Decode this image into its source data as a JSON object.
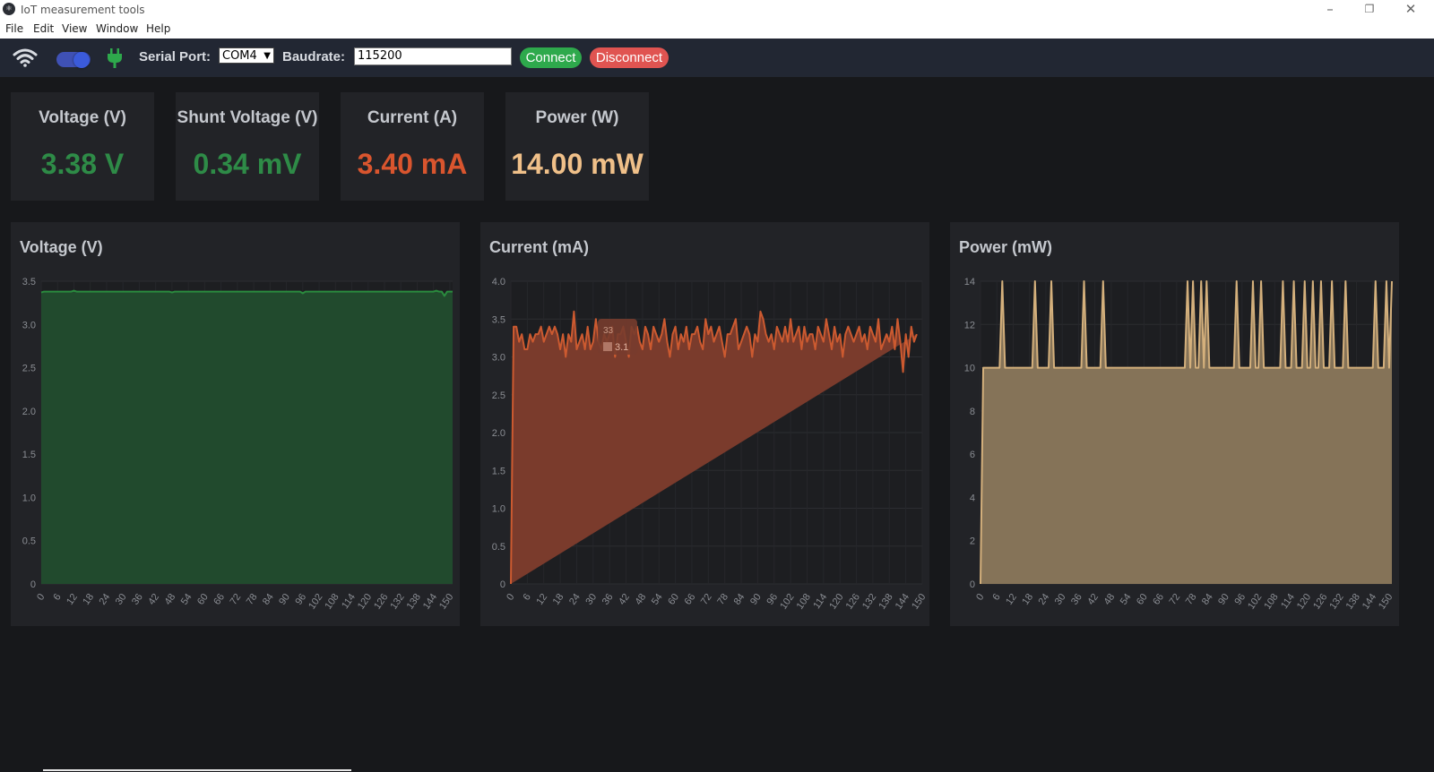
{
  "window": {
    "title": "IoT measurement tools",
    "minimize_icon": "minimize-icon",
    "restore_icon": "restore-icon",
    "close_icon": "close-icon"
  },
  "menu": [
    "File",
    "Edit",
    "View",
    "Window",
    "Help"
  ],
  "toolbar": {
    "wifi_icon": "wifi-icon",
    "toggle_on": true,
    "plug_icon": "plug-icon",
    "serial_port_label": "Serial Port:",
    "serial_port_value": "COM4",
    "baudrate_label": "Baudrate:",
    "baudrate_value": "115200",
    "connect_label": "Connect",
    "disconnect_label": "Disconnect",
    "colors": {
      "toolbar_bg": "#222733",
      "connect": "#2ea94c",
      "disconnect": "#e05451",
      "toggle": "#3f51b5",
      "plug": "#2ea94c"
    }
  },
  "cards": [
    {
      "title": "Voltage (V)",
      "value": "3.38 V",
      "color": "#2e8b47"
    },
    {
      "title": "Shunt Voltage (V)",
      "value": "0.34 mV",
      "color": "#2e8b47"
    },
    {
      "title": "Current (A)",
      "value": "3.40 mA",
      "color": "#d9552e"
    },
    {
      "title": "Power (W)",
      "value": "14.00 mW",
      "color": "#f0c089"
    }
  ],
  "chart_data": [
    {
      "type": "area",
      "title": "Voltage (V)",
      "line_color": "#2a8b3e",
      "fill_color": "#214a2d",
      "ylim": [
        0,
        3.5
      ],
      "yticks": [
        "0",
        "0.5",
        "1.0",
        "1.5",
        "2.0",
        "2.5",
        "3.0",
        "3.5"
      ],
      "x": [
        0,
        1,
        2,
        3,
        4,
        5,
        6,
        7,
        8,
        9,
        10,
        11,
        12,
        13,
        14,
        15,
        16,
        17,
        18,
        19,
        20,
        21,
        22,
        23,
        24,
        25,
        26,
        27,
        28,
        29,
        30,
        31,
        32,
        33,
        34,
        35,
        36,
        37,
        38,
        39,
        40,
        41,
        42,
        43,
        44,
        45,
        46,
        47,
        48,
        49,
        50,
        51,
        52,
        53,
        54,
        55,
        56,
        57,
        58,
        59,
        60,
        61,
        62,
        63,
        64,
        65,
        66,
        67,
        68,
        69,
        70,
        71,
        72,
        73,
        74,
        75,
        76,
        77,
        78,
        79,
        80,
        81,
        82,
        83,
        84,
        85,
        86,
        87,
        88,
        89,
        90,
        91,
        92,
        93,
        94,
        95,
        96,
        97,
        98,
        99,
        100,
        101,
        102,
        103,
        104,
        105,
        106,
        107,
        108,
        109,
        110,
        111,
        112,
        113,
        114,
        115,
        116,
        117,
        118,
        119,
        120,
        121,
        122,
        123,
        124,
        125,
        126,
        127,
        128,
        129,
        130,
        131,
        132,
        133,
        134,
        135,
        136,
        137,
        138,
        139,
        140,
        141,
        142,
        143,
        144,
        145,
        146,
        147,
        148,
        149,
        150,
        151
      ],
      "values": [
        3.37,
        3.38,
        3.38,
        3.38,
        3.38,
        3.38,
        3.38,
        3.38,
        3.38,
        3.38,
        3.38,
        3.38,
        3.39,
        3.38,
        3.38,
        3.38,
        3.38,
        3.38,
        3.38,
        3.38,
        3.38,
        3.38,
        3.38,
        3.38,
        3.38,
        3.38,
        3.38,
        3.38,
        3.38,
        3.38,
        3.38,
        3.38,
        3.38,
        3.38,
        3.38,
        3.38,
        3.38,
        3.38,
        3.38,
        3.38,
        3.38,
        3.38,
        3.38,
        3.38,
        3.38,
        3.38,
        3.38,
        3.38,
        3.37,
        3.38,
        3.38,
        3.38,
        3.38,
        3.38,
        3.38,
        3.38,
        3.38,
        3.38,
        3.38,
        3.38,
        3.38,
        3.38,
        3.38,
        3.38,
        3.38,
        3.38,
        3.38,
        3.38,
        3.38,
        3.38,
        3.38,
        3.38,
        3.38,
        3.38,
        3.38,
        3.38,
        3.38,
        3.38,
        3.38,
        3.38,
        3.38,
        3.38,
        3.38,
        3.38,
        3.38,
        3.38,
        3.38,
        3.38,
        3.38,
        3.38,
        3.38,
        3.38,
        3.38,
        3.38,
        3.38,
        3.38,
        3.36,
        3.38,
        3.38,
        3.38,
        3.38,
        3.38,
        3.38,
        3.38,
        3.38,
        3.38,
        3.38,
        3.38,
        3.38,
        3.38,
        3.38,
        3.38,
        3.38,
        3.38,
        3.38,
        3.38,
        3.38,
        3.38,
        3.38,
        3.38,
        3.38,
        3.38,
        3.38,
        3.38,
        3.38,
        3.38,
        3.38,
        3.38,
        3.38,
        3.38,
        3.38,
        3.38,
        3.38,
        3.38,
        3.38,
        3.38,
        3.38,
        3.38,
        3.38,
        3.38,
        3.38,
        3.38,
        3.38,
        3.38,
        3.38,
        3.39,
        3.38,
        3.38,
        3.33,
        3.38,
        3.38,
        3.38
      ],
      "xticks": [
        "0",
        "6",
        "12",
        "18",
        "24",
        "30",
        "36",
        "42",
        "48",
        "54",
        "60",
        "66",
        "72",
        "78",
        "84",
        "90",
        "96",
        "102",
        "108",
        "114",
        "120",
        "126",
        "132",
        "138",
        "144",
        "150"
      ]
    },
    {
      "type": "area",
      "title": "Current (mA)",
      "line_color": "#cc5a30",
      "fill_color": "#7a3b2c",
      "ylim": [
        0,
        4.0
      ],
      "yticks": [
        "0",
        "0.5",
        "1.0",
        "1.5",
        "2.0",
        "2.5",
        "3.0",
        "3.5",
        "4.0"
      ],
      "tooltip": {
        "x": "33",
        "value": "3.1"
      },
      "x": [
        0,
        1,
        2,
        3,
        4,
        5,
        6,
        7,
        8,
        9,
        10,
        11,
        12,
        13,
        14,
        15,
        16,
        17,
        18,
        19,
        20,
        21,
        22,
        23,
        24,
        25,
        26,
        27,
        28,
        29,
        30,
        31,
        32,
        33,
        34,
        35,
        36,
        37,
        38,
        39,
        40,
        41,
        42,
        43,
        44,
        45,
        46,
        47,
        48,
        49,
        50,
        51,
        52,
        53,
        54,
        55,
        56,
        57,
        58,
        59,
        60,
        61,
        62,
        63,
        64,
        65,
        66,
        67,
        68,
        69,
        70,
        71,
        72,
        73,
        74,
        75,
        76,
        77,
        78,
        79,
        80,
        81,
        82,
        83,
        84,
        85,
        86,
        87,
        88,
        89,
        90,
        91,
        92,
        93,
        94,
        95,
        96,
        97,
        98,
        99,
        100,
        101,
        102,
        103,
        104,
        105,
        106,
        107,
        108,
        109,
        110,
        111,
        112,
        113,
        114,
        115,
        116,
        117,
        118,
        119,
        120,
        121,
        122,
        123,
        124,
        125,
        126,
        127,
        128,
        129,
        130,
        131,
        132,
        133,
        134,
        135,
        136,
        137,
        138,
        139,
        140,
        141,
        142,
        143,
        144,
        145,
        146,
        147,
        148,
        149,
        150
      ],
      "values": [
        0,
        3.4,
        3.4,
        3.2,
        3.3,
        3.1,
        3.1,
        3.3,
        3.2,
        3.3,
        3.3,
        3.4,
        3.2,
        3.3,
        3.4,
        3.3,
        3.4,
        3.3,
        3.1,
        3.3,
        3.0,
        3.3,
        3.2,
        3.6,
        3.1,
        3.2,
        3.3,
        3.1,
        3.4,
        3.1,
        3.2,
        3.5,
        3.2,
        3.1,
        3.3,
        3.2,
        3.3,
        3.4,
        3.0,
        3.3,
        3.3,
        3.4,
        3.2,
        3.0,
        3.4,
        3.3,
        3.4,
        3.2,
        3.1,
        3.4,
        3.3,
        3.1,
        3.4,
        3.3,
        3.2,
        3.3,
        3.5,
        3.2,
        3.0,
        3.3,
        3.4,
        3.1,
        3.3,
        3.2,
        3.4,
        3.1,
        3.3,
        3.3,
        3.4,
        3.2,
        3.1,
        3.5,
        3.3,
        3.4,
        3.2,
        3.3,
        3.4,
        3.2,
        3.0,
        3.3,
        3.3,
        3.4,
        3.5,
        3.1,
        3.2,
        3.3,
        3.4,
        3.3,
        3.0,
        3.3,
        3.2,
        3.6,
        3.5,
        3.3,
        3.2,
        3.3,
        3.1,
        3.4,
        3.3,
        3.2,
        3.4,
        3.2,
        3.5,
        3.2,
        3.3,
        3.4,
        3.1,
        3.4,
        3.2,
        3.3,
        3.3,
        3.1,
        3.4,
        3.3,
        3.2,
        3.5,
        3.3,
        3.1,
        3.4,
        3.2,
        3.3,
        3.0,
        3.3,
        3.4,
        3.3,
        3.2,
        3.3,
        3.4,
        3.2,
        3.3,
        3.1,
        3.4,
        3.3,
        3.2,
        3.5,
        3.1,
        3.2,
        3.3,
        3.2,
        3.4,
        3.1,
        3.5,
        3.2,
        2.8,
        3.3,
        3.0,
        3.4,
        3.2,
        3.3
      ],
      "xticks": [
        "0",
        "6",
        "12",
        "18",
        "24",
        "30",
        "36",
        "42",
        "48",
        "54",
        "60",
        "66",
        "72",
        "78",
        "84",
        "90",
        "96",
        "102",
        "108",
        "114",
        "120",
        "126",
        "132",
        "138",
        "144",
        "150"
      ]
    },
    {
      "type": "area",
      "title": "Power (mW)",
      "line_color": "#d4b07c",
      "fill_color": "#857358",
      "ylim": [
        0,
        14
      ],
      "yticks": [
        "0",
        "2",
        "4",
        "6",
        "8",
        "10",
        "12",
        "14"
      ],
      "x": [
        0,
        1,
        2,
        3,
        4,
        5,
        6,
        7,
        8,
        9,
        10,
        11,
        12,
        13,
        14,
        15,
        16,
        17,
        18,
        19,
        20,
        21,
        22,
        23,
        24,
        25,
        26,
        27,
        28,
        29,
        30,
        31,
        32,
        33,
        34,
        35,
        36,
        37,
        38,
        39,
        40,
        41,
        42,
        43,
        44,
        45,
        46,
        47,
        48,
        49,
        50,
        51,
        52,
        53,
        54,
        55,
        56,
        57,
        58,
        59,
        60,
        61,
        62,
        63,
        64,
        65,
        66,
        67,
        68,
        69,
        70,
        71,
        72,
        73,
        74,
        75,
        76,
        77,
        78,
        79,
        80,
        81,
        82,
        83,
        84,
        85,
        86,
        87,
        88,
        89,
        90,
        91,
        92,
        93,
        94,
        95,
        96,
        97,
        98,
        99,
        100,
        101,
        102,
        103,
        104,
        105,
        106,
        107,
        108,
        109,
        110,
        111,
        112,
        113,
        114,
        115,
        116,
        117,
        118,
        119,
        120,
        121,
        122,
        123,
        124,
        125,
        126,
        127,
        128,
        129,
        130,
        131,
        132,
        133,
        134,
        135,
        136,
        137,
        138,
        139,
        140,
        141,
        142,
        143,
        144,
        145,
        146,
        147,
        148,
        149,
        150,
        151
      ],
      "values": [
        0,
        10,
        10,
        10,
        10,
        10,
        10,
        10,
        14,
        10,
        10,
        10,
        10,
        10,
        10,
        10,
        10,
        10,
        10,
        10,
        14,
        10,
        10,
        10,
        10,
        10,
        14,
        10,
        10,
        10,
        10,
        10,
        10,
        10,
        10,
        10,
        10,
        10,
        14,
        10,
        10,
        10,
        10,
        10,
        10,
        14,
        10,
        10,
        10,
        10,
        10,
        10,
        10,
        10,
        10,
        10,
        10,
        10,
        10,
        10,
        10,
        10,
        10,
        10,
        10,
        10,
        10,
        10,
        10,
        10,
        10,
        10,
        10,
        10,
        10,
        10,
        14,
        10,
        14,
        10,
        10,
        14,
        10,
        14,
        10,
        10,
        10,
        10,
        10,
        10,
        10,
        10,
        10,
        10,
        14,
        10,
        10,
        10,
        10,
        10,
        14,
        10,
        10,
        14,
        10,
        10,
        10,
        10,
        10,
        10,
        10,
        14,
        10,
        10,
        10,
        14,
        10,
        10,
        10,
        14,
        10,
        10,
        14,
        10,
        10,
        14,
        10,
        10,
        10,
        14,
        10,
        10,
        10,
        10,
        14,
        10,
        10,
        10,
        10,
        10,
        10,
        10,
        10,
        10,
        10,
        14,
        10,
        10,
        10,
        14,
        10,
        14
      ],
      "xticks": [
        "0",
        "6",
        "12",
        "18",
        "24",
        "30",
        "36",
        "42",
        "48",
        "54",
        "60",
        "66",
        "72",
        "78",
        "84",
        "90",
        "96",
        "102",
        "108",
        "114",
        "120",
        "126",
        "132",
        "138",
        "144",
        "150"
      ]
    }
  ]
}
